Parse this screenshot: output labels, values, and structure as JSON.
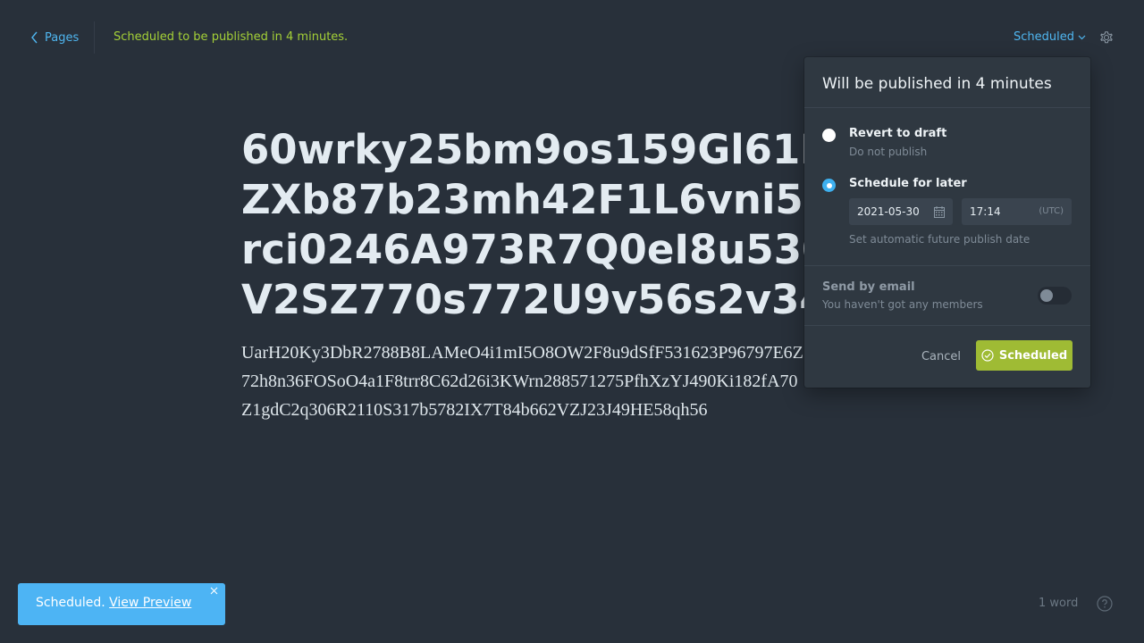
{
  "header": {
    "back_label": "Pages",
    "status_message": "Scheduled to be published in 4 minutes.",
    "status_toggle_label": "Scheduled"
  },
  "editor": {
    "title": "60wrky25bm9os159Gl61R4H\nZXb87b23mh42F1L6vni5042\nrci0246A973R7Q0eI8u530gN\nV2SZ770s772U9v56s2v349f",
    "body": "UarH20Ky3DbR2788B8LAMeO4i1mI5O8OW2F8u9dSfF531623P96797E6Z\n72h8n36FOSoO4a1F8trr8C62d26i3KWrn288571275PfhXzYJ490Ki182fA70\nZ1gdC2q306R2110S317b5782IX7T84b662VZJ23J49HE58qh56"
  },
  "publish_menu": {
    "heading": "Will be published in 4 minutes",
    "revert_label": "Revert to draft",
    "revert_desc": "Do not publish",
    "schedule_label": "Schedule for later",
    "selected_option": "schedule",
    "date_value": "2021-05-30",
    "time_value": "17:14",
    "timezone": "(UTC)",
    "schedule_help": "Set automatic future publish date",
    "email_label": "Send by email",
    "email_desc": "You haven't got any members",
    "email_enabled": false,
    "cancel_label": "Cancel",
    "submit_label": "Scheduled"
  },
  "footer": {
    "word_count": "1 word"
  },
  "toast": {
    "message": "Scheduled.",
    "link_label": "View Preview"
  },
  "colors": {
    "background": "#28303a",
    "accent_blue": "#4fb6f0",
    "status_green": "#a4d037",
    "button_green": "#9fbb34",
    "toast_blue": "#4db4f4"
  }
}
